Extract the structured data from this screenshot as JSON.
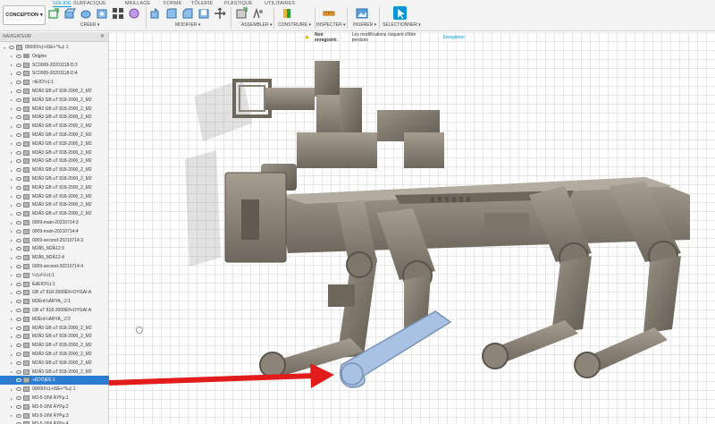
{
  "workspace": {
    "label": "CONCEPTION"
  },
  "tabs": [
    {
      "label": "SOLIDE",
      "active": true
    },
    {
      "label": "SURFACIQUE",
      "active": false
    },
    {
      "label": "MAILLAGE",
      "active": false
    },
    {
      "label": "FORME",
      "active": false
    },
    {
      "label": "TÔLERIE",
      "active": false
    },
    {
      "label": "PLASTIQUE",
      "active": false
    },
    {
      "label": "UTILITAIRES",
      "active": false
    }
  ],
  "groups": [
    {
      "label": "CRÉER ▾"
    },
    {
      "label": "MODIFIER ▾"
    },
    {
      "label": "ASSEMBLER ▾"
    },
    {
      "label": "CONSTRUIRE ▾"
    },
    {
      "label": "INSPECTER ▾"
    },
    {
      "label": "INSÉRER ▾"
    },
    {
      "label": "SÉLECTIONNER ▾"
    }
  ],
  "save_notice": {
    "status": "Non enregistré:",
    "message": "Les modifications risquent d'être perdues",
    "action": "Enregistrer"
  },
  "browser": {
    "title": "NAVIGATEUR",
    "root": "0000II⅓‡+iSE+°‰‡ 1",
    "items": [
      "Origine",
      "SC0009-20201118-D:3",
      "SC0009-20201118-D:4",
      "□iEIO⅓‡:1",
      "M2Ä3 GB uT 818-2000_2_M2",
      "M2Ä3 GB uT 818-2000_2_M2",
      "M2Ä3 GB uT 818-2000_2_M2",
      "M2Ä3 GB uT 818-2000_2_M2",
      "M2Ä3 GB uT 818-2000_2_M2",
      "M2Ä3 GB uT 818-2000_2_M2",
      "M2Ä3 GB uT 818-2000_2_M2",
      "M2Ä3 GB uT 818-2000_2_M2",
      "M2Ä3 GB uT 818-2000_2_M2",
      "M2Ä3 GB uT 818-2000_2_M2",
      "M2Ä3 GB uT 818-2000_2_M2",
      "M2Ä3 GB uT 818-2000_2_M2",
      "M2Ä3 GB uT 818-2000_2_M2",
      "M2Ä3 GB uT 818-2000_2_M2",
      "M2Ä3 GB uT 818-2000_2_M2",
      "0009-main-20210714:3",
      "0009-main-20210714:4",
      "0009-second-20210714:3",
      "M2Ä5_M2Ä12:3",
      "M2Ä5_M2Ä12:4",
      "0009-second-20210714:4",
      "¼‡ʊ¼⅓‡:1",
      "ÉdEIO⅓‡:1",
      "GB uT 818-2000Èfl+OYGAI:A",
      "M2Ènt¼ÀRYA_:2:1",
      "GB uT 818-2000Èfl+OYGAI:A",
      "M2Ènt¼ÀRYA_:2:2",
      "M2Ä3 GB uT 818-2000_2_M2",
      "M2Ä3 GB uT 818-2000_2_M2",
      "M2Ä3 GB uT 818-2000_2_M2",
      "M2Ä3 GB uT 818-2000_2_M2",
      "M2Ä3 GB uT 818-2000_2_M2",
      "M2Ä3 GB uT 818-2000_2_M2",
      "»ÉDÖ|ÈÉ:1",
      "0000II⅓‡+iSE+°‰‡ 1",
      "M3-5-1INI ÄYPµ:1",
      "M3-5-1INI ÄYPµ:2",
      "M3-5-1INI ÄYPµ:3",
      "M3-5-1INI ÄYPµ:4"
    ]
  },
  "colors": {
    "accent": "#0696d7",
    "selection": "#2b7cd3",
    "model": "#8c8478",
    "highlight_part": "#a9c1e2",
    "arrow": "#e21b1b"
  }
}
